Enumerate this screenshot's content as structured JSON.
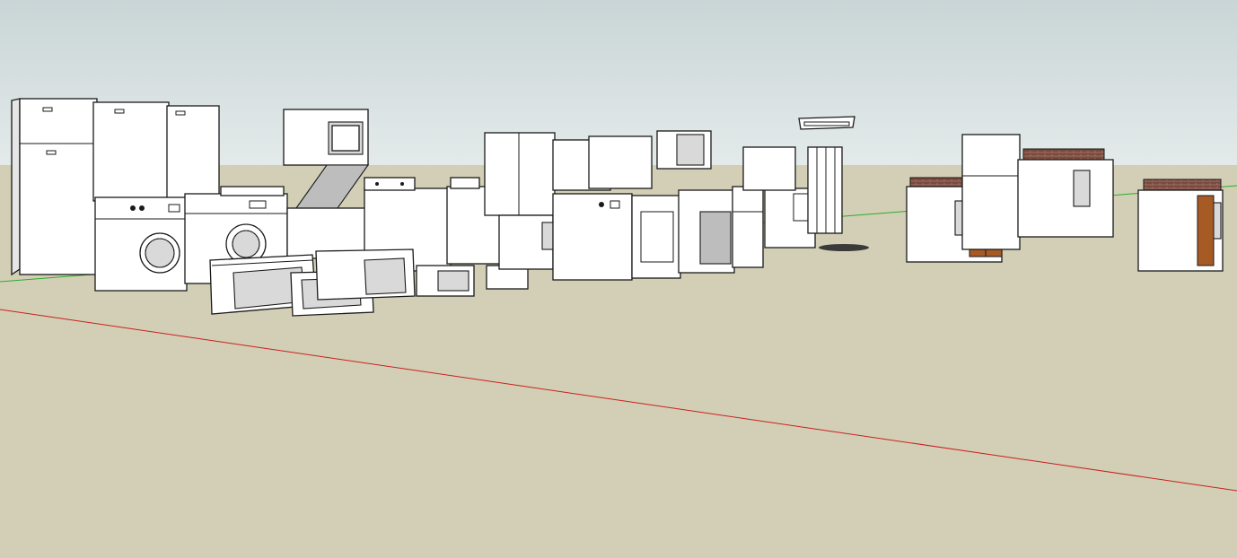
{
  "scene": {
    "colors": {
      "sky_top": "#c9d5d6",
      "sky_bottom": "#e4eaea",
      "ground": "#d2cfb6",
      "red_axis": "#cc1f1f",
      "green_axis": "#2bab2b",
      "model_fill": "#ffffff",
      "model_edge": "#1a1a1a",
      "wood": "#a65a24",
      "brick": "#7a4a3e"
    },
    "axes": [
      "red-axis",
      "green-axis"
    ],
    "groups": [
      "refrigerators",
      "washers-and-dryers",
      "microwaves",
      "stacked-laundry-unit",
      "ranges-and-ovens",
      "dishwashers",
      "range-hood",
      "kitchen-counter-units"
    ]
  }
}
